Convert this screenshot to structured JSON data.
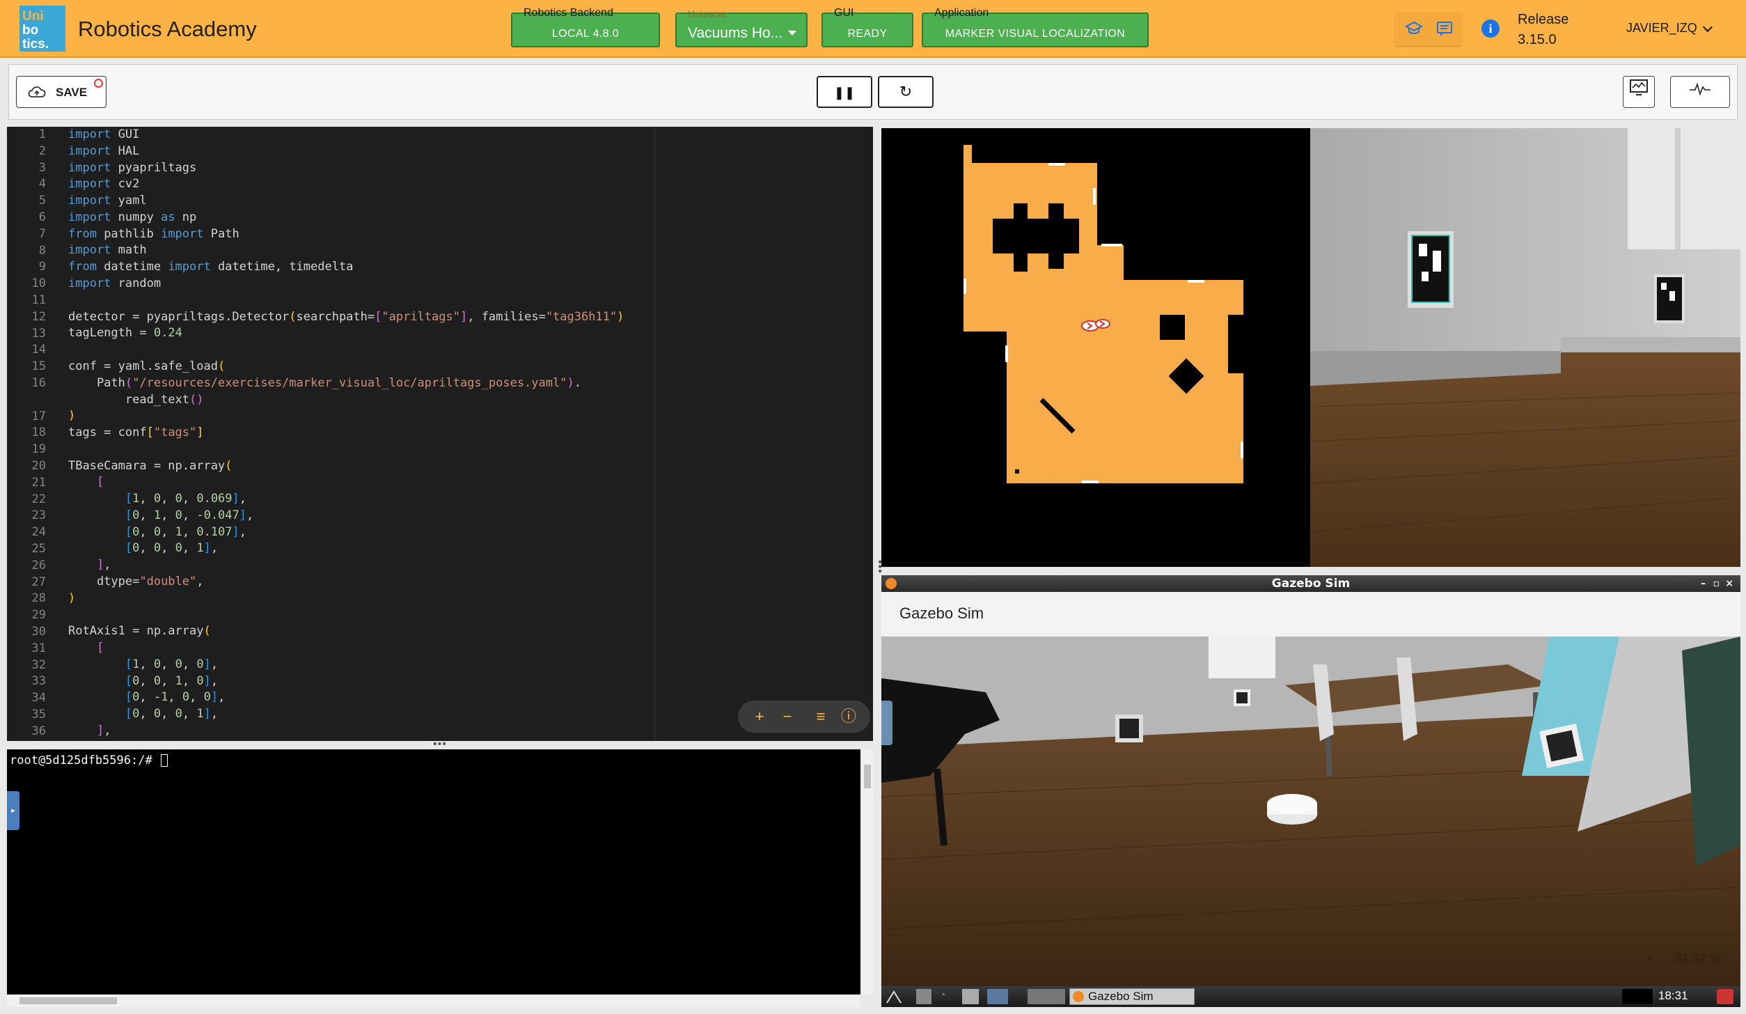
{
  "header": {
    "logo_lines": [
      "Uni",
      "bo",
      "tics."
    ],
    "app_title": "Robotics Academy",
    "backend": {
      "caption": "Robotics Backend",
      "value": "LOCAL 4.8.0"
    },
    "universe": {
      "caption": "Universe",
      "value": "Vacuums Ho..."
    },
    "gui": {
      "caption": "GUI",
      "value": "READY"
    },
    "application": {
      "caption": "Application",
      "value": "MARKER VISUAL LOCALIZATION"
    },
    "release_label": "Release",
    "release_version": "3.15.0",
    "user": "JAVIER_IZQ",
    "icons": [
      "graduation-cap-icon",
      "chat-icon",
      "info-icon"
    ]
  },
  "toolbar": {
    "save_label": "SAVE",
    "pause_symbol": "❚❚",
    "reset_symbol": "↻"
  },
  "editor": {
    "line_numbers": [
      "1",
      "2",
      "3",
      "4",
      "5",
      "6",
      "7",
      "8",
      "9",
      "10",
      "11",
      "12",
      "13",
      "14",
      "15",
      "16",
      "",
      "17",
      "18",
      "19",
      "20",
      "21",
      "22",
      "23",
      "24",
      "25",
      "26",
      "27",
      "28",
      "29",
      "30",
      "31",
      "32",
      "33",
      "34",
      "35",
      "36"
    ],
    "tool_symbols": [
      "+",
      "−",
      "≡",
      "ⓘ"
    ]
  },
  "terminal": {
    "prompt": "root@5d125dfb5596:/# "
  },
  "gazebo": {
    "window_title": "Gazebo Sim",
    "panel_title": "Gazebo Sim",
    "zoom": "81.92 %",
    "taskbar_window": "Gazebo Sim",
    "clock": "18:31"
  },
  "colors": {
    "header_bg": "#fdb244",
    "status_green": "#4caf50",
    "editor_bg": "#1e1e1e",
    "map_floor": "#f9ad4a"
  }
}
